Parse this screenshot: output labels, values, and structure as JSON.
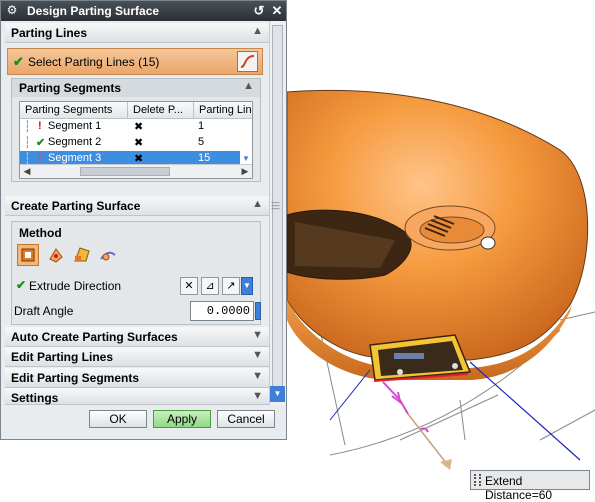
{
  "dialog": {
    "title": "Design Parting Surface",
    "icons": {
      "title_icon": "gear-icon",
      "reset": "reset-icon",
      "close": "close-icon"
    }
  },
  "parting_lines": {
    "header": "Parting Lines",
    "select_label": "Select Parting Lines (15)",
    "select_icon": "curve-select-icon"
  },
  "parting_segments": {
    "header": "Parting Segments",
    "columns": [
      "Parting Segments",
      "Delete P...",
      "Parting Lin"
    ],
    "rows": [
      {
        "status": "warning",
        "name": "Segment 1",
        "delete": "x-icon",
        "lines": "1",
        "selected": false
      },
      {
        "status": "ok",
        "name": "Segment 2",
        "delete": "x-icon",
        "lines": "5",
        "selected": false
      },
      {
        "status": "warning",
        "name": "Segment 3",
        "delete": "x-icon",
        "lines": "15",
        "selected": true
      }
    ]
  },
  "create_surface": {
    "header": "Create Parting Surface",
    "method_label": "Method",
    "method_icons": [
      "extrude-method-icon",
      "sweep-method-icon",
      "bounded-plane-icon",
      "extension-method-icon"
    ],
    "extrude_label": "Extrude Direction",
    "draft_label": "Draft Angle",
    "draft_value": "0.0000"
  },
  "collapsed_sections": [
    "Auto Create Parting Surfaces",
    "Edit Parting Lines",
    "Edit Parting Segments",
    "Settings"
  ],
  "buttons": {
    "ok": "OK",
    "apply": "Apply",
    "cancel": "Cancel"
  },
  "viewport": {
    "extend_label": "Extend Distance=60"
  },
  "colors": {
    "part_orange": "#f08a2c",
    "accent_blue": "#3d8de0",
    "title_bar": "#33383e"
  }
}
